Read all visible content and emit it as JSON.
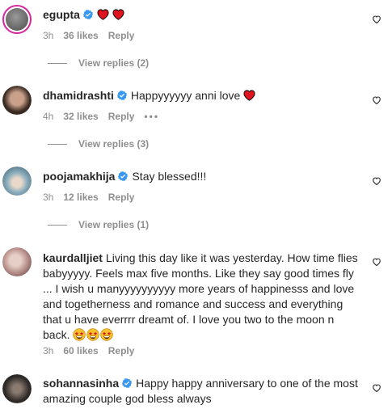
{
  "comments": [
    {
      "username": "egupta",
      "text": "",
      "time": "3h",
      "likes": "36 likes",
      "reply": "Reply",
      "view_replies": "View replies (2)",
      "avatar_color": "#6b6b6b"
    },
    {
      "username": "dhamidrashti",
      "text": "Happyyyyyy anni love",
      "time": "4h",
      "likes": "32 likes",
      "reply": "Reply",
      "more": "•••",
      "view_replies": "View replies (3)",
      "avatar_color": "#3a2a22"
    },
    {
      "username": "poojamakhija",
      "text": "Stay blessed!!!",
      "time": "3h",
      "likes": "12 likes",
      "reply": "Reply",
      "view_replies": "View replies (1)",
      "avatar_color": "#5d7f8e"
    },
    {
      "username": "kaurdalljiet",
      "text": "Living this day like it was yesterday. How time flies babyyyyy. Feels max five months. Like they say good times fly ... I wish u manyyyyyyyyyy more years of happinesss and love and togetherness and romance and success and everything that u have everrrr dreamt of. I love you two to the moon n back.",
      "time": "3h",
      "likes": "60 likes",
      "reply": "Reply",
      "avatar_color": "#b58c88"
    },
    {
      "username": "sohannasinha",
      "text": "Happy happy anniversary to one of the most amazing couple god bless always",
      "avatar_color": "#2e2a28"
    }
  ],
  "colors": {
    "text": "#262626",
    "meta": "#8e8e8e",
    "verified": "#3897f0",
    "heart": "#ed4956",
    "story_ring": "#d6249f"
  },
  "icons": [
    "verified-badge-icon",
    "heart-outline-icon",
    "red-heart-emoji",
    "star-struck-emoji"
  ]
}
